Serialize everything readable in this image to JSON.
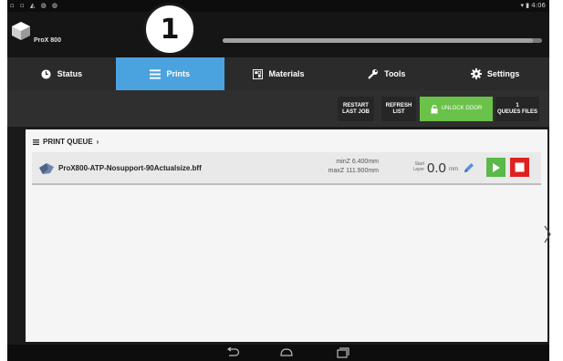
{
  "statusbar": {
    "right": "▾ ▮ 4:06"
  },
  "header": {
    "model": "ProX 800",
    "badge": "1",
    "progress": 0.97
  },
  "tabs": [
    {
      "label": "Status",
      "icon": "clock-icon"
    },
    {
      "label": "Prints",
      "icon": "list-icon"
    },
    {
      "label": "Materials",
      "icon": "materials-icon"
    },
    {
      "label": "Tools",
      "icon": "wrench-icon"
    },
    {
      "label": "Settings",
      "icon": "gear-icon"
    }
  ],
  "toolbar": {
    "restart_line1": "RESTART",
    "restart_line2": "LAST JOB",
    "refresh_line1": "REFRESH",
    "refresh_line2": "LIST",
    "unlock": "UNLOCK DOOR",
    "queue_count": "1",
    "queue_label": "QUEUES FILES"
  },
  "queue": {
    "title": "PRINT QUEUE",
    "job": {
      "name": "ProX800-ATP-Nosupport-90Actualsize.bff",
      "minz": "minZ 6.400mm",
      "maxz": "maxZ 111.900mm",
      "layer_label_1": "Start",
      "layer_label_2": "Layer",
      "layer_value": "0.0",
      "layer_unit": "mm"
    }
  },
  "colors": {
    "accent": "#4aa3de",
    "play": "#5ab948",
    "stop": "#e02020",
    "unlock": "#6ac24a"
  }
}
